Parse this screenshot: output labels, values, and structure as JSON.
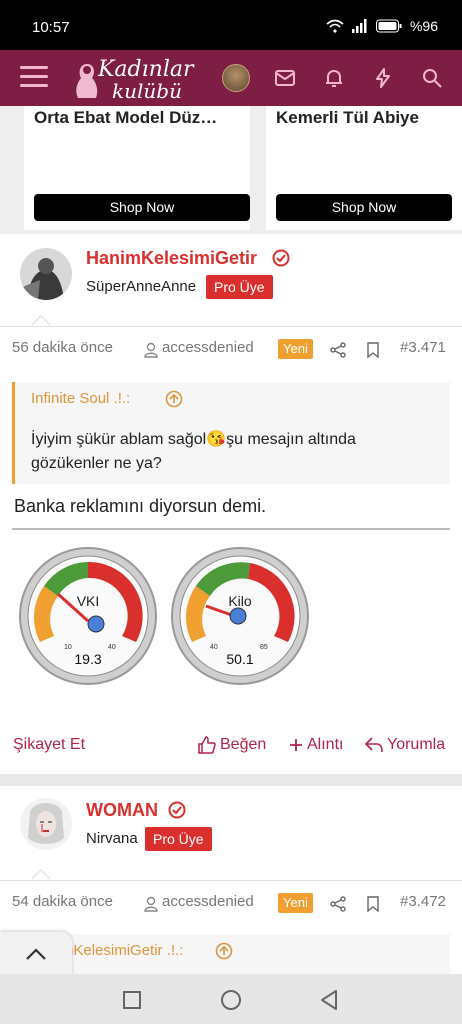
{
  "status_bar": {
    "time": "10:57",
    "battery": "%96"
  },
  "header": {
    "logo_line1": "Kadınlar",
    "logo_line2": "kulübü",
    "icons": [
      "menu-icon",
      "avatar",
      "mail-icon",
      "bell-icon",
      "bolt-icon",
      "search-icon"
    ]
  },
  "ads": [
    {
      "title": "Orta Ebat Model Düz…",
      "button": "Shop Now"
    },
    {
      "title": "Kemerli Tül Abiye",
      "button": "Shop Now"
    }
  ],
  "posts": [
    {
      "username": "HanimKelesimiGetir",
      "user_title": "SüperAnneAnne",
      "badge": "Pro Üye",
      "time": "56 dakika önce",
      "source": "accessdenied",
      "new_label": "Yeni",
      "post_number": "#3.471",
      "quote": {
        "author": "Infinite Soul .!.:",
        "text_before": "İyiyim şükür ablam sağol",
        "emoji": "😘",
        "text_after": "şu mesajın altında gözükenler ne ya?"
      },
      "message": "Banka reklamını diyorsun demi.",
      "gauges": [
        {
          "label": "VKI",
          "min": "10",
          "max": "40",
          "value": "19.3"
        },
        {
          "label": "Kilo",
          "min": "40",
          "max": "85",
          "value": "50.1"
        }
      ],
      "actions": {
        "report": "Şikayet Et",
        "like": "Beğen",
        "quote": "Alıntı",
        "reply": "Yorumla"
      }
    },
    {
      "username": "WOMAN",
      "user_title": "Nirvana",
      "badge": "Pro Üye",
      "time": "54 dakika önce",
      "source": "accessdenied",
      "new_label": "Yeni",
      "post_number": "#3.472",
      "quote": {
        "author": "nKelesimiGetir .!.:"
      }
    }
  ],
  "colors": {
    "brand": "#7e1e45",
    "accent_red": "#d9302e",
    "quote_orange": "#f0a030",
    "action": "#b0244a"
  }
}
